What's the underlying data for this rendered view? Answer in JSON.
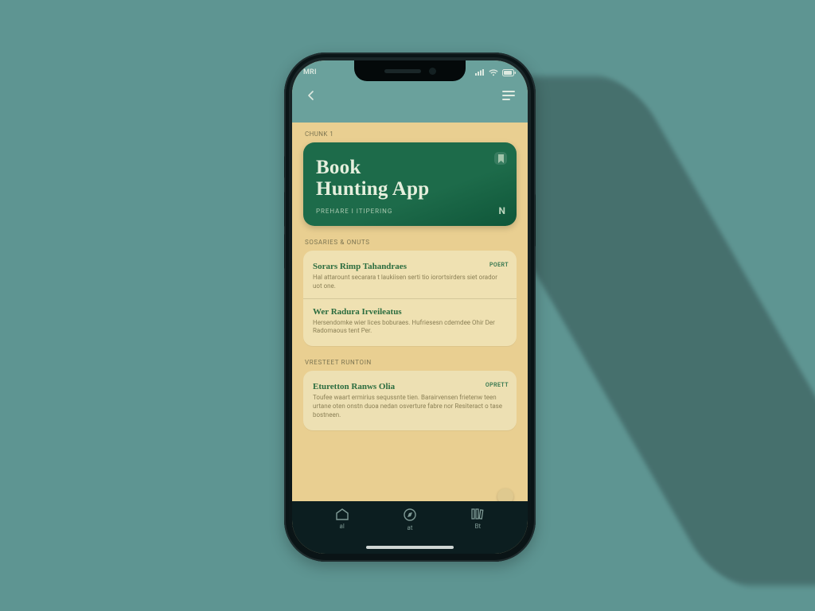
{
  "status": {
    "left_label": "MRI",
    "time": "",
    "indicators": [
      "signal",
      "wifi",
      "battery"
    ]
  },
  "nav": {
    "back_label": "",
    "menu_label": ""
  },
  "breadcrumb": "Chunk 1",
  "hero": {
    "title_line1": "Book",
    "title_line2": "Hunting App",
    "subtitle": "Prehare i Itipering",
    "marker": "N",
    "bookmark": "bookmark"
  },
  "sections": [
    {
      "label": "Sosaries & Onuts",
      "items": [
        {
          "title": "Sorars Rimp Tahandraes",
          "body": "Hal attarount secarara t laukiisen serti tio iorortsirders siet orador uot one.",
          "badge": "Poert"
        },
        {
          "title": "Wer Radura Irveileatus",
          "body": "Hersendomke wier lices boburaes.\nHufriesesn cdemdee Ohir Der Radomaous tent Per.",
          "badge": ""
        }
      ]
    },
    {
      "label": "Vresteet Runtoin",
      "items": [
        {
          "title": "Eturetton Ranws Olia",
          "body": "Toufee waart ermirius sequssnte tien. Barairvensen frietenw teen urtane oten onstn duoa nedan osver­ture fabre nor Resiteract o tase bostneen.",
          "badge": "Oprett"
        }
      ]
    }
  ],
  "tabs": [
    {
      "id": "home",
      "label": "al"
    },
    {
      "id": "browse",
      "label": "at"
    },
    {
      "id": "library",
      "label": "Bt"
    }
  ],
  "colors": {
    "background": "#5e9592",
    "hero": "#1d6b4a",
    "screen": "#e9cf91",
    "tabbar": "#0c1e20"
  }
}
